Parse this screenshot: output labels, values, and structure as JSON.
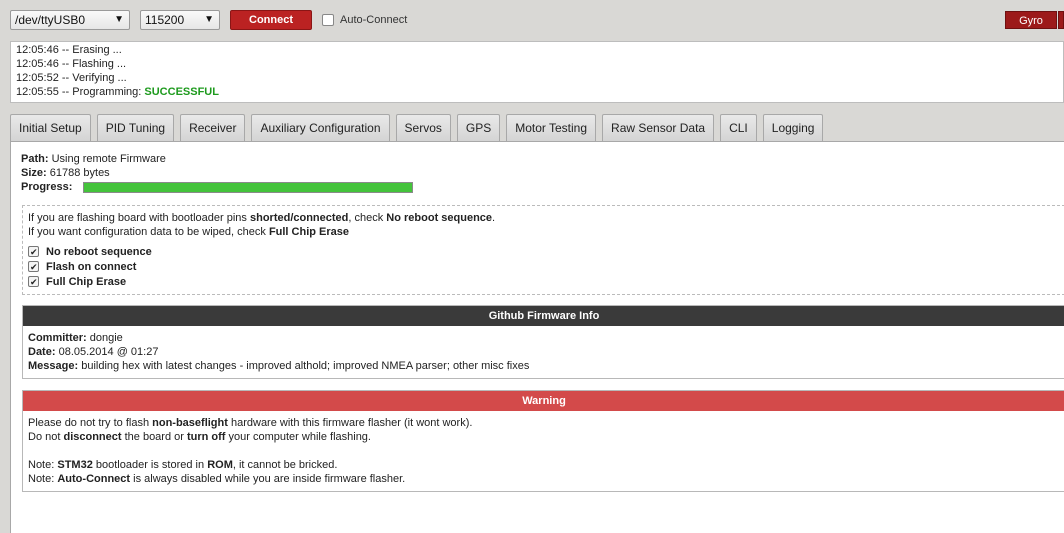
{
  "topbar": {
    "port": "/dev/ttyUSB0",
    "baud": "115200",
    "connect_label": "Connect",
    "auto_connect_label": "Auto-Connect",
    "sensor_label": "Gyro"
  },
  "log": [
    {
      "time": "12:05:46",
      "text": " -- Erasing ..."
    },
    {
      "time": "12:05:46",
      "text": " -- Flashing ..."
    },
    {
      "time": "12:05:52",
      "text": " -- Verifying ..."
    },
    {
      "time": "12:05:55",
      "text": " -- Programming: ",
      "status": "SUCCESSFUL"
    }
  ],
  "tabs": [
    "Initial Setup",
    "PID Tuning",
    "Receiver",
    "Auxiliary Configuration",
    "Servos",
    "GPS",
    "Motor Testing",
    "Raw Sensor Data",
    "CLI",
    "Logging"
  ],
  "firmware": {
    "path_label": "Path:",
    "path_value": "Using remote Firmware",
    "size_label": "Size:",
    "size_value": "61788 bytes",
    "progress_label": "Progress:",
    "progress": 1.0
  },
  "options": {
    "line1": {
      "a": "If you are flashing board with bootloader pins ",
      "b": "shorted/connected",
      "c": ", check ",
      "d": "No reboot sequence",
      "e": "."
    },
    "line2": {
      "a": "If you want configuration data to be wiped, check ",
      "b": "Full Chip Erase"
    },
    "checkboxes": [
      "No reboot sequence",
      "Flash on connect",
      "Full Chip Erase"
    ]
  },
  "github": {
    "title": "Github Firmware Info",
    "committer_label": "Committer:",
    "committer": "dongie",
    "date_label": "Date:",
    "date": "08.05.2014 @ 01:27",
    "message_label": "Message:",
    "message": "building hex with latest changes - improved althold; improved NMEA parser; other misc fixes"
  },
  "warning": {
    "title": "Warning",
    "l1": {
      "a": "Please do not try to flash ",
      "b": "non-baseflight",
      "c": " hardware with this firmware flasher (it wont work)."
    },
    "l2": {
      "a": "Do not ",
      "b": "disconnect",
      "c": " the board or ",
      "d": "turn off",
      "e": " your computer while flashing."
    },
    "l3": {
      "a": "Note: ",
      "b": "STM32",
      "c": " bootloader is stored in ",
      "d": "ROM",
      "e": ", it cannot be bricked."
    },
    "l4": {
      "a": "Note: ",
      "b": "Auto-Connect",
      "c": " is always disabled while you are inside firmware flasher."
    }
  },
  "colors": {
    "connect": "#bb2222",
    "success": "#1d9a1d",
    "progress": "#44c33b",
    "warning": "#d34a4a",
    "github_header": "#3a3a3a"
  }
}
